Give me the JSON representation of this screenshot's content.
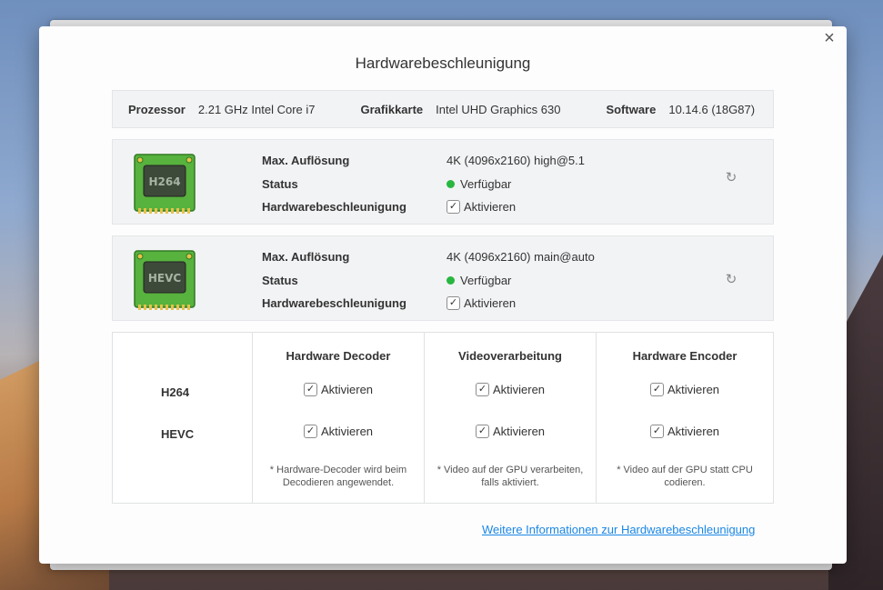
{
  "dialog": {
    "title": "Hardwarebeschleunigung",
    "close_icon": "close-icon"
  },
  "info": {
    "processor_label": "Prozessor",
    "processor_value": "2.21 GHz Intel Core i7",
    "gpu_label": "Grafikkarte",
    "gpu_value": "Intel UHD Graphics 630",
    "software_label": "Software",
    "software_value": "10.14.6 (18G87)"
  },
  "codecs": [
    {
      "chip_label": "H264",
      "res_label": "Max. Auflösung",
      "res_value": "4K (4096x2160) high@5.1",
      "status_label": "Status",
      "status_value": "Verfügbar",
      "hw_label": "Hardwarebeschleunigung",
      "hw_value": "Aktivieren"
    },
    {
      "chip_label": "HEVC",
      "res_label": "Max. Auflösung",
      "res_value": "4K (4096x2160) main@auto",
      "status_label": "Status",
      "status_value": "Verfügbar",
      "hw_label": "Hardwarebeschleunigung",
      "hw_value": "Aktivieren"
    }
  ],
  "matrix": {
    "rows": [
      "H264",
      "HEVC"
    ],
    "columns": [
      {
        "header": "Hardware Decoder",
        "cell": "Aktivieren",
        "note": "* Hardware-Decoder wird beim Decodieren angewendet."
      },
      {
        "header": "Videoverarbeitung",
        "cell": "Aktivieren",
        "note": "* Video auf der GPU verarbeiten, falls aktiviert."
      },
      {
        "header": "Hardware Encoder",
        "cell": "Aktivieren",
        "note": "* Video auf der GPU statt CPU codieren."
      }
    ]
  },
  "link": "Weitere Informationen zur Hardwarebeschleunigung",
  "colors": {
    "status_ok": "#28b740",
    "link": "#1a87e6",
    "chip_green": "#4fae3a"
  }
}
